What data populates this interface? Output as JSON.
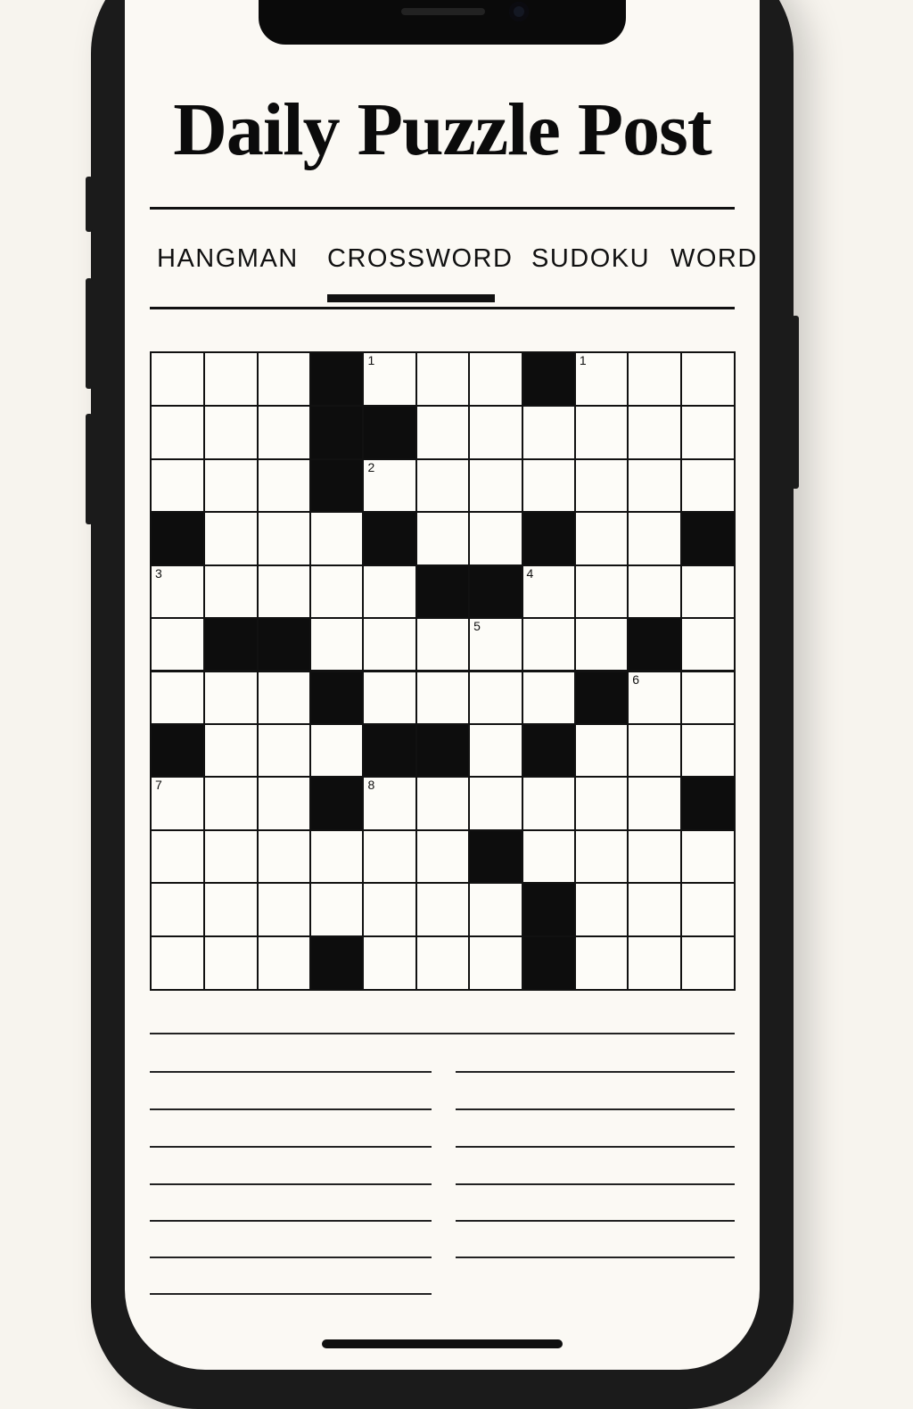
{
  "app": {
    "title": "Daily Puzzle Post"
  },
  "tabs": [
    {
      "label": "HANGMAN"
    },
    {
      "label": "CROSSWORD",
      "selected": true
    },
    {
      "label": "SUDOKU"
    },
    {
      "label": "WORD"
    }
  ],
  "crossword": {
    "rows": 12,
    "cols": 11,
    "black_cells": [
      [
        0,
        3
      ],
      [
        0,
        7
      ],
      [
        1,
        3
      ],
      [
        1,
        4
      ],
      [
        2,
        3
      ],
      [
        3,
        0
      ],
      [
        3,
        4
      ],
      [
        3,
        7
      ],
      [
        3,
        10
      ],
      [
        4,
        5
      ],
      [
        4,
        6
      ],
      [
        5,
        1
      ],
      [
        5,
        2
      ],
      [
        5,
        9
      ],
      [
        6,
        3
      ],
      [
        6,
        8
      ],
      [
        7,
        0
      ],
      [
        7,
        4
      ],
      [
        7,
        5
      ],
      [
        7,
        7
      ],
      [
        8,
        3
      ],
      [
        8,
        10
      ],
      [
        9,
        6
      ],
      [
        10,
        7
      ],
      [
        11,
        3
      ],
      [
        11,
        7
      ]
    ],
    "numbers": [
      {
        "r": 0,
        "c": 4,
        "label": "1"
      },
      {
        "r": 0,
        "c": 8,
        "label": "1"
      },
      {
        "r": 2,
        "c": 4,
        "label": "2"
      },
      {
        "r": 4,
        "c": 0,
        "label": "3"
      },
      {
        "r": 4,
        "c": 7,
        "label": "4"
      },
      {
        "r": 5,
        "c": 6,
        "label": "5"
      },
      {
        "r": 6,
        "c": 9,
        "label": "6"
      },
      {
        "r": 8,
        "c": 0,
        "label": "7"
      },
      {
        "r": 8,
        "c": 4,
        "label": "8"
      }
    ]
  },
  "colors": {
    "background": "#f7f4ee",
    "screen": "#fbf9f4",
    "ink": "#111111"
  }
}
